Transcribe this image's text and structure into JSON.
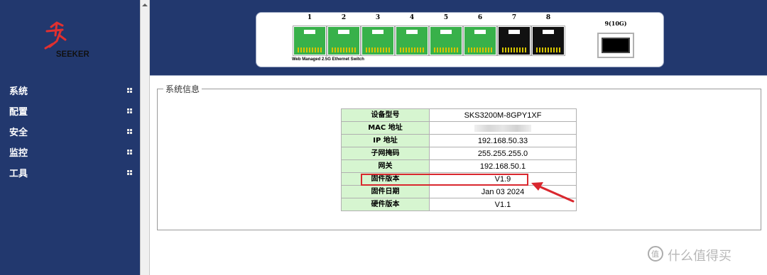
{
  "brand": {
    "logo_text": "SEEKER"
  },
  "sidebar": {
    "items": [
      {
        "label": "系统"
      },
      {
        "label": "配置"
      },
      {
        "label": "安全"
      },
      {
        "label": "监控"
      },
      {
        "label": "工具"
      }
    ]
  },
  "switch_panel": {
    "ports": [
      {
        "number": "1",
        "status": "green"
      },
      {
        "number": "2",
        "status": "green"
      },
      {
        "number": "3",
        "status": "green"
      },
      {
        "number": "4",
        "status": "green"
      },
      {
        "number": "5",
        "status": "green"
      },
      {
        "number": "6",
        "status": "green"
      },
      {
        "number": "7",
        "status": "black"
      },
      {
        "number": "8",
        "status": "black"
      }
    ],
    "caption": "Web Managed 2.5G Ethernet Switch",
    "sfp_label": "9(10G)"
  },
  "system_info": {
    "legend": "系统信息",
    "rows": [
      {
        "key": "设备型号",
        "value": "SKS3200M-8GPY1XF"
      },
      {
        "key": "MAC 地址",
        "value": ""
      },
      {
        "key": "IP 地址",
        "value": "192.168.50.33"
      },
      {
        "key": "子网掩码",
        "value": "255.255.255.0"
      },
      {
        "key": "网关",
        "value": "192.168.50.1"
      },
      {
        "key": "固件版本",
        "value": "V1.9"
      },
      {
        "key": "固件日期",
        "value": "Jan 03 2024"
      },
      {
        "key": "硬件版本",
        "value": "V1.1"
      }
    ]
  },
  "watermark": {
    "text": "什么值得买"
  },
  "colors": {
    "navy": "#22386e",
    "port_green": "#38b14a",
    "key_cell_bg": "#d6f5d0",
    "highlight_red": "#d9272e"
  }
}
